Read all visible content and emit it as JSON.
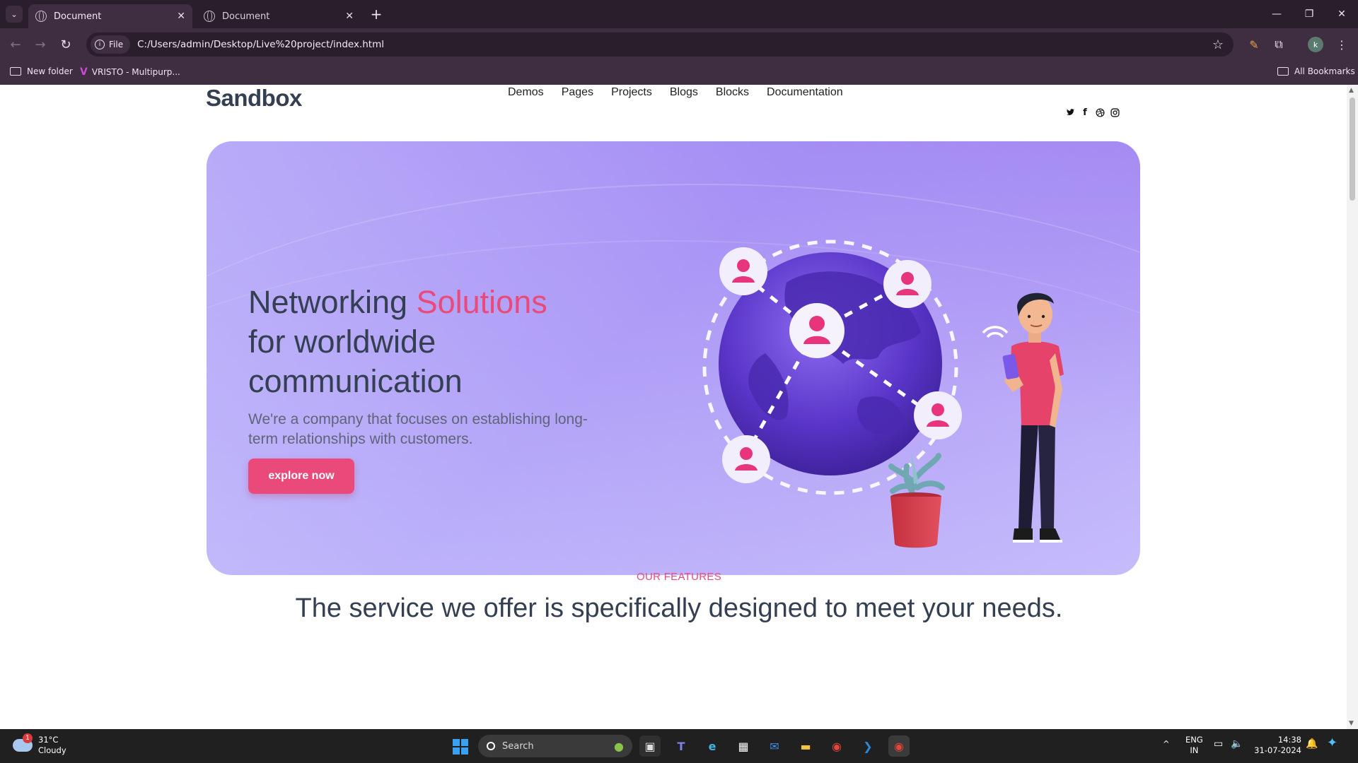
{
  "browser": {
    "tabs": [
      {
        "title": "Document",
        "active": true
      },
      {
        "title": "Document",
        "active": false
      }
    ],
    "address": {
      "chip_label": "File",
      "url": "C:/Users/admin/Desktop/Live%20project/index.html"
    },
    "bookmarks": [
      {
        "label": "New folder",
        "icon": "folder-icon"
      },
      {
        "label": "VRISTO - Multipurp...",
        "icon": "vristo-icon"
      }
    ],
    "all_bookmarks_label": "All Bookmarks",
    "profile_initial": "k"
  },
  "site": {
    "logo": "Sandbox",
    "nav": [
      "Demos",
      "Pages",
      "Projects",
      "Blogs",
      "Blocks",
      "Documentation"
    ],
    "social": [
      {
        "icon": "twitter-icon",
        "glyph": "🐦"
      },
      {
        "icon": "facebook-icon",
        "glyph": "f"
      },
      {
        "icon": "dribbble-icon",
        "glyph": "⊛"
      },
      {
        "icon": "instagram-icon",
        "glyph": "◎"
      }
    ],
    "hero": {
      "title_part1": "Networking",
      "title_accent": "Solutions",
      "title_part2": "for worldwide communication",
      "lead": "We're a company that focuses on establishing long-term relationships with customers.",
      "cta": "explore now"
    },
    "features": {
      "label": "OUR FEATURES",
      "title": "The service we offer is specifically designed to meet your needs."
    }
  },
  "taskbar": {
    "weather_temp": "31°C",
    "weather_desc": "Cloudy",
    "weather_badge": "1",
    "search_placeholder": "Search",
    "language_line1": "ENG",
    "language_line2": "IN",
    "time": "14:38",
    "date": "31-07-2024"
  },
  "colors": {
    "accent": "#e94a7a",
    "heading": "#343f52",
    "hero_bg": "#b0a0f6",
    "chrome_dark": "#2a1d2c",
    "chrome": "#3f2e42"
  }
}
